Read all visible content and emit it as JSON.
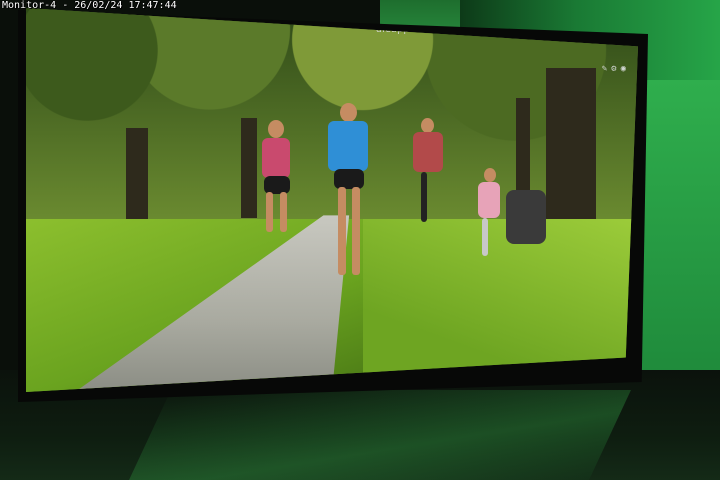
{
  "camera_overlay": {
    "camera_name": "Monitor-4",
    "separator": " - ",
    "date": "26/02/24",
    "time": "17:47:44"
  },
  "monitor": {
    "brand_text": "dieapp",
    "scene": "park-joggers"
  },
  "colors": {
    "wall_green": "#26a548",
    "bezel": "#070807",
    "osd_text": "#ffffff"
  }
}
